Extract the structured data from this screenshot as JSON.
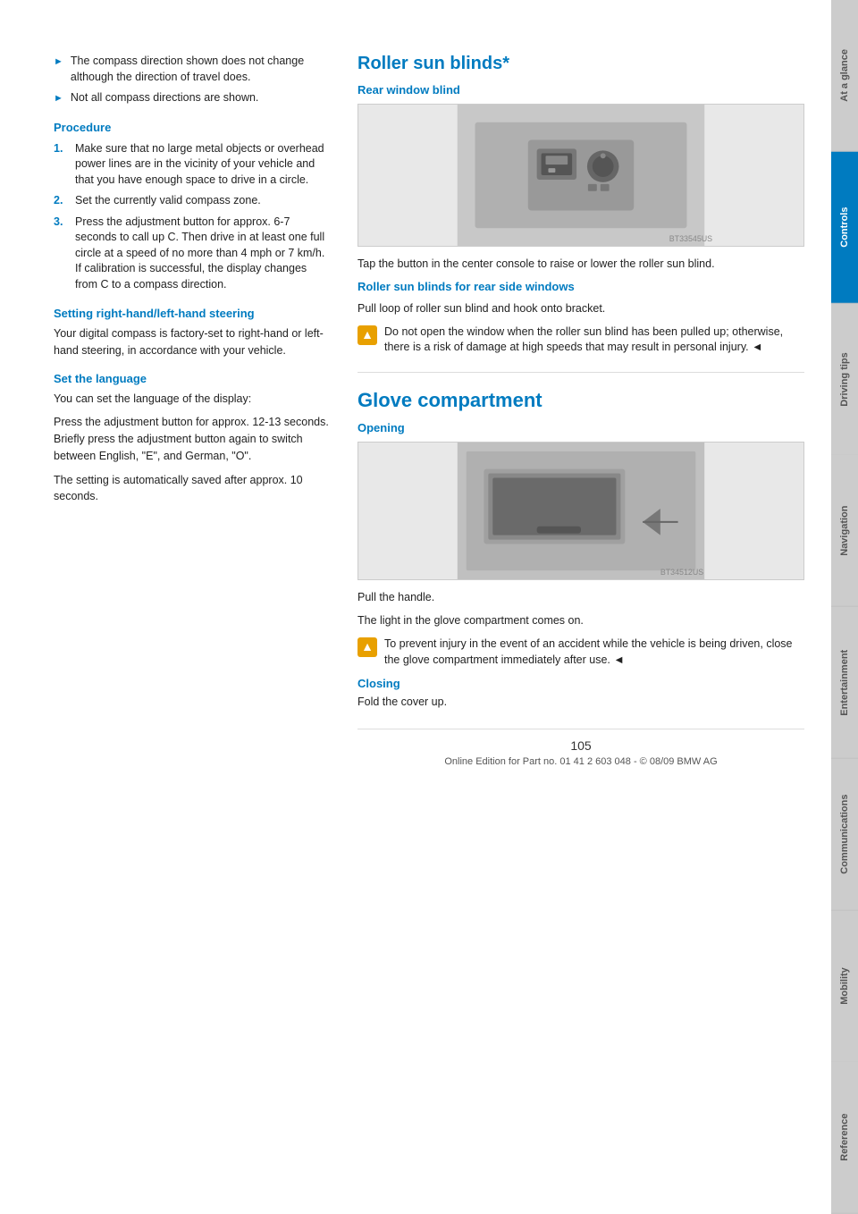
{
  "sidebar": {
    "tabs": [
      {
        "label": "At a glance",
        "active": false
      },
      {
        "label": "Controls",
        "active": true
      },
      {
        "label": "Driving tips",
        "active": false
      },
      {
        "label": "Navigation",
        "active": false
      },
      {
        "label": "Entertainment",
        "active": false
      },
      {
        "label": "Communications",
        "active": false
      },
      {
        "label": "Mobility",
        "active": false
      },
      {
        "label": "Reference",
        "active": false
      }
    ]
  },
  "left_column": {
    "bullets": [
      "The compass direction shown does not change although the direction of travel does.",
      "Not all compass directions are shown."
    ],
    "procedure_heading": "Procedure",
    "procedure_steps": [
      "Make sure that no large metal objects or overhead power lines are in the vicinity of your vehicle and that you have enough space to drive in a circle.",
      "Set the currently valid compass zone.",
      "Press the adjustment button for approx. 6-7 seconds to call up C. Then drive in at least one full circle at a speed of no more than 4 mph or 7 km/h.\nIf calibration is successful, the display changes from C to a compass direction."
    ],
    "steering_heading": "Setting right-hand/left-hand steering",
    "steering_text": "Your digital compass is factory-set to right-hand or left-hand steering, in accordance with your vehicle.",
    "language_heading": "Set the language",
    "language_text1": "You can set the language of the display:",
    "language_text2": "Press the adjustment button for approx. 12-13 seconds. Briefly press the adjustment button again to switch between English, \"E\", and German, \"O\".",
    "language_text3": "The setting is automatically saved after approx. 10 seconds."
  },
  "right_column": {
    "roller_title": "Roller sun blinds*",
    "rear_window_heading": "Rear window blind",
    "rear_window_text": "Tap the button in the center console to raise or lower the roller sun blind.",
    "roller_side_heading": "Roller sun blinds for rear side windows",
    "roller_side_text": "Pull loop of roller sun blind and hook onto bracket.",
    "roller_warning": "Do not open the window when the roller sun blind has been pulled up; otherwise, there is a risk of damage at high speeds that may result in personal injury.",
    "roller_warning_end": "◄",
    "glove_title": "Glove compartment",
    "opening_heading": "Opening",
    "glove_open_text1": "Pull the handle.",
    "glove_open_text2": "The light in the glove compartment comes on.",
    "glove_warning": "To prevent injury in the event of an accident while the vehicle is being driven, close the glove compartment immediately after use.",
    "glove_warning_end": "◄",
    "closing_heading": "Closing",
    "closing_text": "Fold the cover up."
  },
  "footer": {
    "page_number": "105",
    "footer_text": "Online Edition for Part no. 01 41 2 603 048 - © 08/09 BMW AG"
  },
  "colors": {
    "accent": "#007bc0",
    "warning": "#e8a000"
  }
}
